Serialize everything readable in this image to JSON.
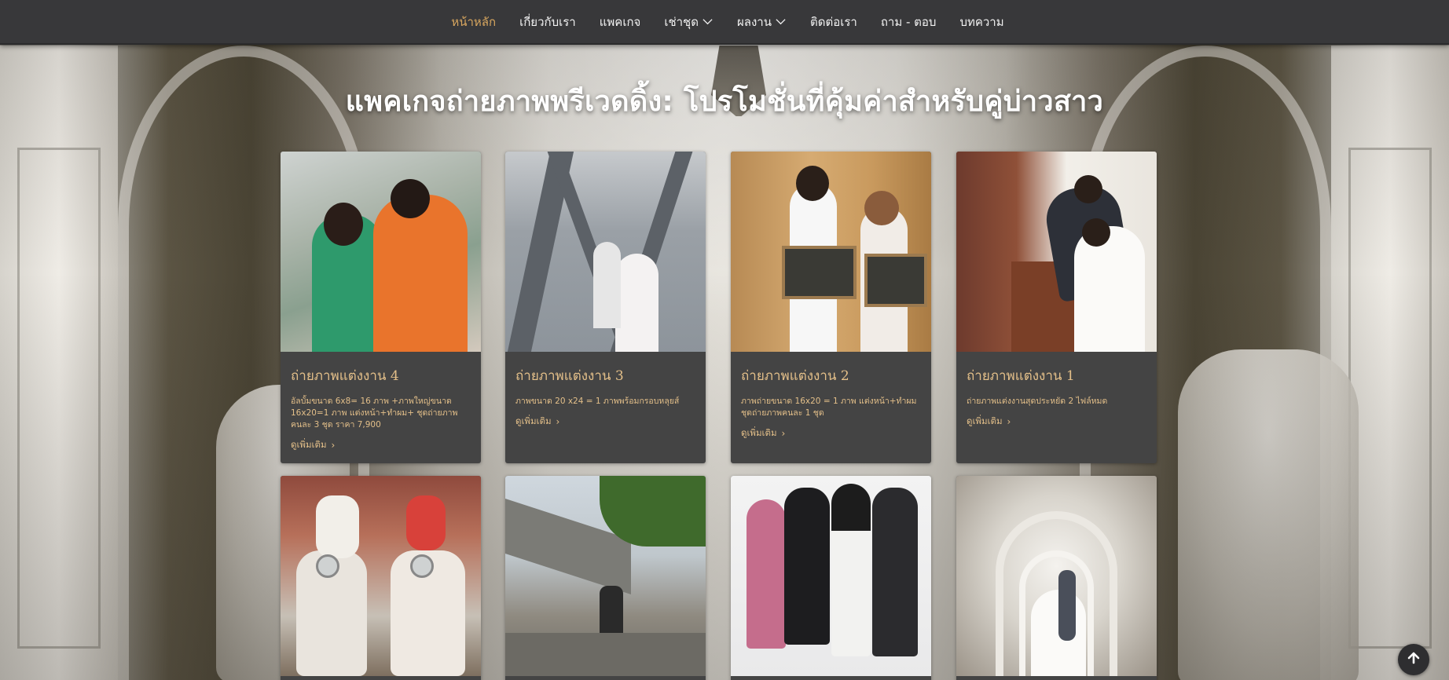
{
  "nav": {
    "items": [
      {
        "label": "หน้าหลัก",
        "active": true,
        "dropdown": false
      },
      {
        "label": "เกี่ยวกับเรา",
        "active": false,
        "dropdown": false
      },
      {
        "label": "แพคเกจ",
        "active": false,
        "dropdown": false
      },
      {
        "label": "เช่าชุด",
        "active": false,
        "dropdown": true
      },
      {
        "label": "ผลงาน",
        "active": false,
        "dropdown": true
      },
      {
        "label": "ติดต่อเรา",
        "active": false,
        "dropdown": false
      },
      {
        "label": "ถาม - ตอบ",
        "active": false,
        "dropdown": false
      },
      {
        "label": "บทความ",
        "active": false,
        "dropdown": false
      }
    ],
    "active_color": "#d9a75f"
  },
  "page": {
    "title": "แพคเกจถ่ายภาพพรีเวดดิ้ง: โปรโมชั่นที่คุ้มค่าสำหรับคู่บ่าวสาว"
  },
  "cards": [
    {
      "title": "ถ่ายภาพแต่งงาน 4",
      "description": "อัลบั้มขนาด  6x8= 16 ภาพ +ภาพใหญ่ขนาด 16x20=1 ภาพ แต่งหน้า+ทำผม+ ชุดถ่ายภาพคนละ 3 ชุด ราคา 7,900",
      "more": "ดูเพิ่มเติม",
      "photo": "couple-sports-jackets"
    },
    {
      "title": "ถ่ายภาพแต่งงาน 3",
      "description": "ภาพขนาด 20 x24 = 1 ภาพพร้อมกรอบหลุยส์",
      "more": "ดูเพิ่มเติม",
      "photo": "couple-on-bridge"
    },
    {
      "title": "ถ่ายภาพแต่งงาน 2",
      "description": "ภาพถ่ายขนาด 16x20 = 1 ภาพ แต่งหน้า+ทำผม ชุดถ่ายภาพคนละ 1 ชุด",
      "more": "ดูเพิ่มเติม",
      "photo": "couple-with-signs"
    },
    {
      "title": "ถ่ายภาพแต่งงาน 1",
      "description": "ถ่ายภาพแต่งงานสุดประหยัด 2 ไฟล์หมด",
      "more": "ดูเพิ่มเติม",
      "photo": "couple-at-piano"
    },
    {
      "photo": "couple-on-scooters"
    },
    {
      "photo": "couple-city-street"
    },
    {
      "photo": "graduation-family"
    },
    {
      "photo": "couple-in-hallway"
    }
  ],
  "colors": {
    "nav_bg": "#38383a",
    "card_bg": "#444444",
    "card_text": "#e3bf89",
    "title_text": "#ffffff"
  },
  "icons": {
    "dropdown": "chevron-down-icon",
    "card_more": "chevron-right-icon",
    "scroll_top": "arrow-up-icon"
  }
}
